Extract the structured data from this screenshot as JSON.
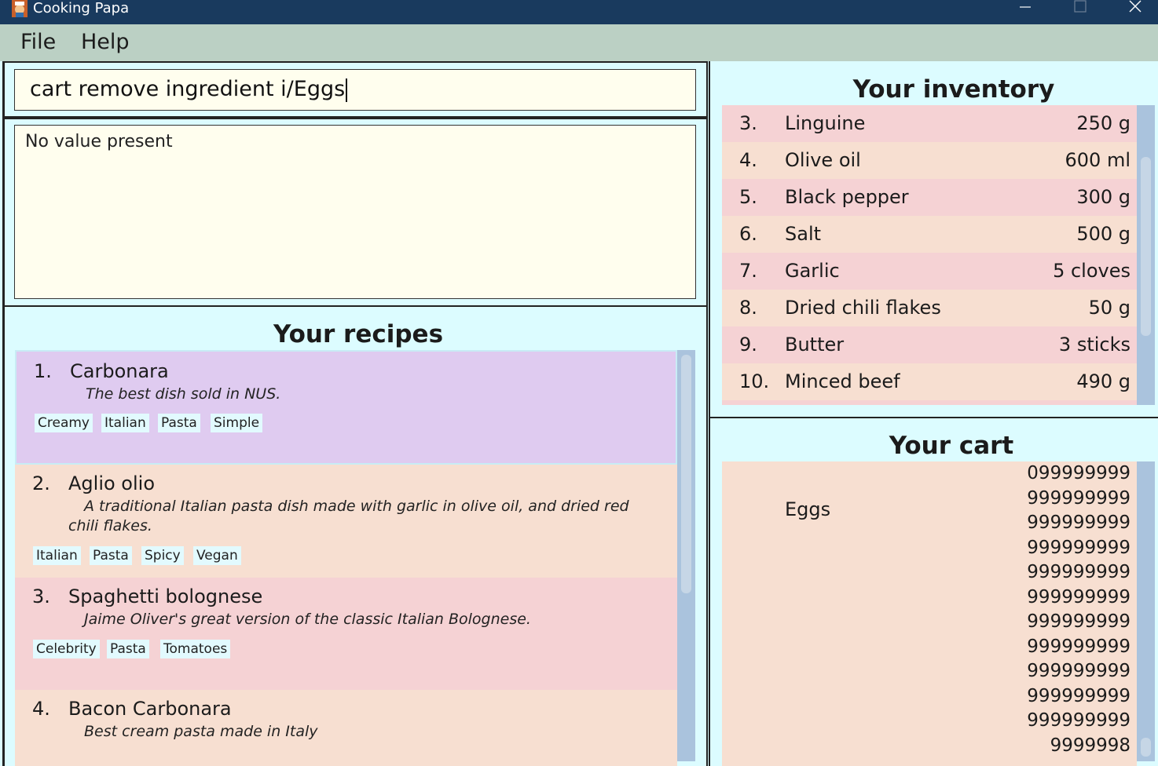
{
  "window": {
    "title": "Cooking Papa",
    "icon": "chef-icon",
    "controls": [
      "minimize-icon",
      "maximize-icon",
      "close-icon"
    ]
  },
  "menu": {
    "file": "File",
    "help": "Help"
  },
  "command": {
    "value": "cart remove ingredient i/Eggs"
  },
  "result": {
    "text": "No value present"
  },
  "recipes": {
    "heading": "Your recipes",
    "items": [
      {
        "index": "1.",
        "name": "Carbonara",
        "description": "The best dish sold in NUS.",
        "tags": [
          "Creamy",
          "Italian",
          "Pasta",
          "Simple"
        ],
        "selected": true
      },
      {
        "index": "2.",
        "name": "Aglio olio",
        "description_line1": "A traditional Italian pasta dish made with garlic in olive oil, and dried red",
        "description_line2": "chili flakes.",
        "tags": [
          "Italian",
          "Pasta",
          "Spicy",
          "Vegan"
        ]
      },
      {
        "index": "3.",
        "name": "Spaghetti bolognese",
        "description": "Jaime Oliver's great version of the classic Italian Bolognese.",
        "tags": [
          "Celebrity",
          "Pasta",
          "Tomatoes"
        ]
      },
      {
        "index": "4.",
        "name": "Bacon Carbonara",
        "description": "Best cream pasta made in Italy"
      }
    ]
  },
  "inventory": {
    "heading": "Your inventory",
    "items": [
      {
        "index": "3.",
        "name": "Linguine",
        "quantity": "250 g"
      },
      {
        "index": "4.",
        "name": "Olive oil",
        "quantity": "600 ml"
      },
      {
        "index": "5.",
        "name": "Black pepper",
        "quantity": "300 g"
      },
      {
        "index": "6.",
        "name": "Salt",
        "quantity": "500 g"
      },
      {
        "index": "7.",
        "name": "Garlic",
        "quantity": "5 cloves"
      },
      {
        "index": "8.",
        "name": "Dried chili flakes",
        "quantity": "50 g"
      },
      {
        "index": "9.",
        "name": "Butter",
        "quantity": "3 sticks"
      },
      {
        "index": "10.",
        "name": "Minced beef",
        "quantity": "490 g"
      }
    ]
  },
  "cart": {
    "heading": "Your cart",
    "items": [
      {
        "name": "Eggs",
        "quantity": "099999999\n999999999\n999999999\n999999999\n999999999\n999999999\n999999999\n999999999\n999999999\n999999999\n999999999\n9999998"
      }
    ]
  },
  "colors": {
    "titlebar": "#193a5e",
    "menubar": "#bbd0c4",
    "background": "#dcfcff",
    "input_background": "#fffeee",
    "selected_card": "#dfcbf0",
    "row_pink": "#f5d2d4",
    "row_peach": "#f7dfd1",
    "tag_background": "#e2fafe",
    "scrollbar": "#aac3dd"
  }
}
